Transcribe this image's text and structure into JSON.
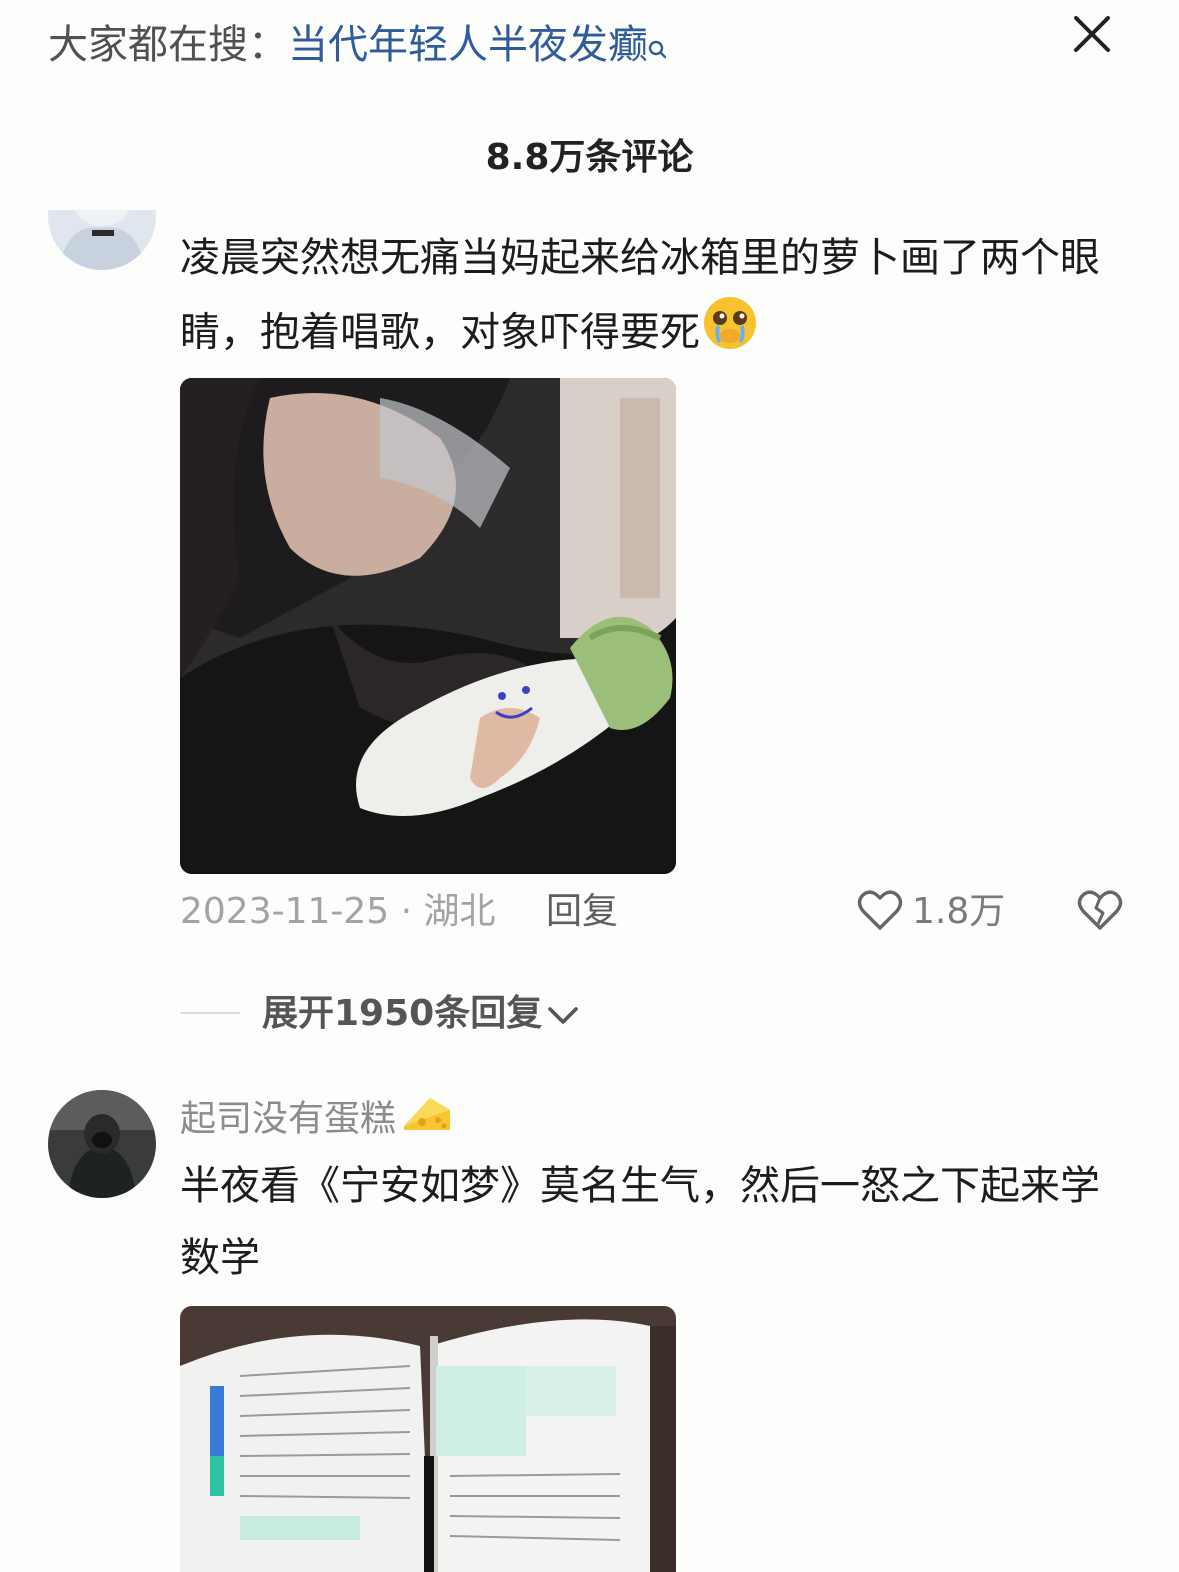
{
  "header": {
    "search_prefix": "大家都在搜：",
    "search_keyword": "当代年轻人半夜发癫",
    "search_icon": "search-icon",
    "close_icon": "close-icon"
  },
  "comment_count": "8.8万条评论",
  "comments": [
    {
      "text": "凌晨突然想无痛当妈起来给冰箱里的萝卜画了两个眼睛，抱着唱歌，对象吓得要死",
      "emoji": "crying-face-emoji",
      "date_location": "2023-11-25 · 湖北",
      "reply_label": "回复",
      "likes": "1.8万",
      "like_icon": "heart-icon",
      "dislike_icon": "broken-heart-icon",
      "expand_label": "展开1950条回复"
    },
    {
      "username": "起司没有蛋糕",
      "username_emoji": "cheese-emoji",
      "text": "半夜看《宁安如梦》莫名生气，然后一怒之下起来学数学"
    }
  ]
}
